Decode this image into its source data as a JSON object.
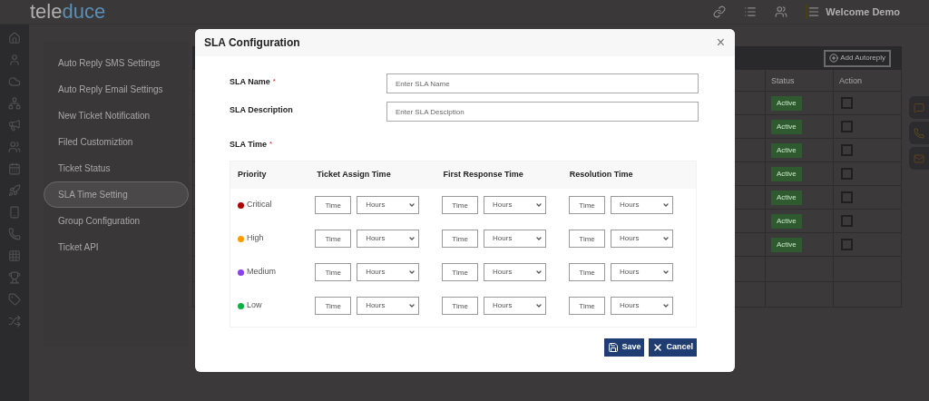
{
  "header": {
    "logo_parts": [
      "tele",
      "duce"
    ],
    "user": "Welcome Demo"
  },
  "settings_menu": {
    "items": [
      {
        "label": "Auto Reply SMS Settings",
        "selected": false
      },
      {
        "label": "Auto Reply Email Settings",
        "selected": false
      },
      {
        "label": "New Ticket Notification",
        "selected": false
      },
      {
        "label": "Filed Customiztion",
        "selected": false
      },
      {
        "label": "Ticket Status",
        "selected": false
      },
      {
        "label": "SLA Time Setting",
        "selected": true
      },
      {
        "label": "Group Configuration",
        "selected": false
      },
      {
        "label": "Ticket API",
        "selected": false
      }
    ]
  },
  "table": {
    "add_button": "Add Autoreply",
    "columns": [
      "Status",
      "Action"
    ],
    "rows": [
      {
        "status": "Active",
        "checked": false
      },
      {
        "status": "Active",
        "checked": false
      },
      {
        "status": "Active",
        "checked": false
      },
      {
        "status": "Active",
        "checked": false
      },
      {
        "status": "Active",
        "checked": false
      },
      {
        "status": "Active",
        "checked": false
      },
      {
        "status": "Active",
        "checked": false
      }
    ]
  },
  "modal": {
    "title": "SLA Configuration",
    "close": "×",
    "fields": [
      {
        "label": "SLA Name",
        "required": true,
        "required_mark": "*",
        "placeholder": "Enter SLA Name"
      },
      {
        "label": "SLA Description",
        "required": false,
        "placeholder": "Enter SLA Desciption"
      }
    ],
    "sla_time": {
      "label": "SLA Time",
      "required": true,
      "required_mark": "*",
      "columns": [
        "Priority",
        "Ticket Assign Time",
        "First Response Time",
        "Resolution Time"
      ],
      "rows": [
        {
          "cells": [
            {
              "kind": "priority",
              "label": "Critical",
              "color": "#b00000"
            },
            {
              "kind": "time",
              "placeholder": "Time",
              "unit": "Hours"
            },
            {
              "kind": "time",
              "placeholder": "Time",
              "unit": "Hours"
            },
            {
              "kind": "time",
              "placeholder": "Time",
              "unit": "Hours"
            }
          ]
        },
        {
          "cells": [
            {
              "kind": "priority",
              "label": "High",
              "color": "#ff9a00"
            },
            {
              "kind": "time",
              "placeholder": "Time",
              "unit": "Hours"
            },
            {
              "kind": "time",
              "placeholder": "Time",
              "unit": "Hours"
            },
            {
              "kind": "time",
              "placeholder": "Time",
              "unit": "Hours"
            }
          ]
        },
        {
          "cells": [
            {
              "kind": "priority",
              "label": "Medium",
              "color": "#8a3ff0"
            },
            {
              "kind": "time",
              "placeholder": "Time",
              "unit": "Hours"
            },
            {
              "kind": "time",
              "placeholder": "Time",
              "unit": "Hours"
            },
            {
              "kind": "time",
              "placeholder": "Time",
              "unit": "Hours"
            }
          ]
        },
        {
          "cells": [
            {
              "kind": "priority",
              "label": "Low",
              "color": "#10b040"
            },
            {
              "kind": "time",
              "placeholder": "Time",
              "unit": "Hours"
            },
            {
              "kind": "time",
              "placeholder": "Time",
              "unit": "Hours"
            },
            {
              "kind": "time",
              "placeholder": "Time",
              "unit": "Hours"
            }
          ]
        }
      ]
    },
    "buttons": [
      {
        "label": "Save",
        "kind": "save"
      },
      {
        "label": "Cancel",
        "kind": "cancel"
      }
    ]
  }
}
